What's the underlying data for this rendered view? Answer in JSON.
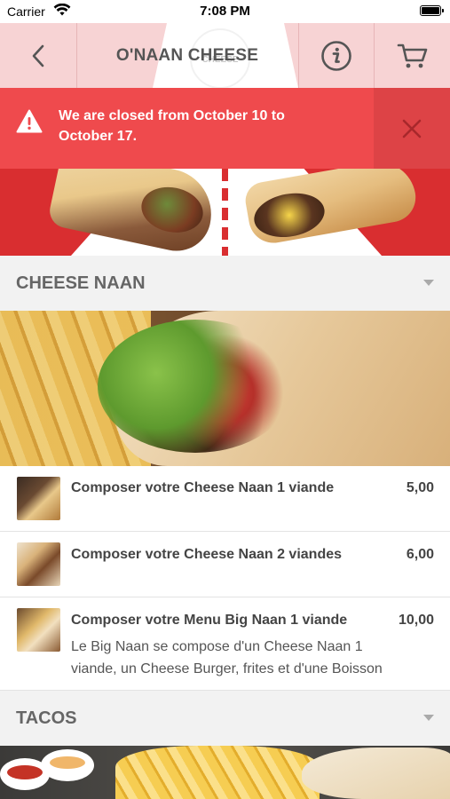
{
  "status_bar": {
    "carrier": "Carrier",
    "time": "7:08 PM"
  },
  "header": {
    "title": "O'NAAN CHEESE",
    "logo_text": "CHEESE"
  },
  "alert": {
    "message": "We are closed from October 10 to October 17."
  },
  "sections": [
    {
      "label": "CHEESE NAAN"
    },
    {
      "label": "TACOS"
    }
  ],
  "menu_items": [
    {
      "name": "Composer votre Cheese Naan 1 viande",
      "price": "5,00",
      "description": ""
    },
    {
      "name": "Composer votre Cheese Naan 2 viandes",
      "price": "6,00",
      "description": ""
    },
    {
      "name": "Composer votre Menu Big Naan 1 viande",
      "price": "10,00",
      "description": "Le Big Naan se compose d'un Cheese Naan 1 viande, un Cheese Burger, frites et d'une Boisson"
    }
  ],
  "colors": {
    "nav_background": "#f7d3d4",
    "alert_background": "#ef4a4d",
    "hero_red": "#d92e30"
  }
}
